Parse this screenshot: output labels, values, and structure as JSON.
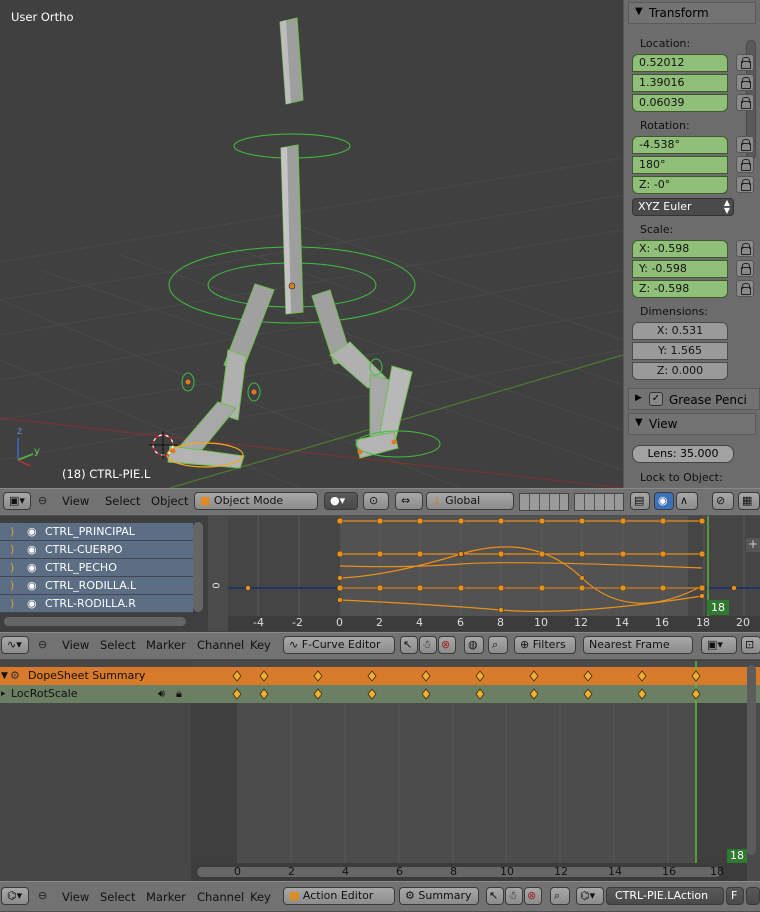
{
  "viewport": {
    "view_name": "User Ortho",
    "object_label": "(18) CTRL-PIE.L",
    "axis_z": "z",
    "axis_y": "y"
  },
  "properties": {
    "transform_title": "Transform",
    "location_label": "Location:",
    "location": [
      "0.52012",
      "1.39016",
      "0.06039"
    ],
    "rotation_label": "Rotation:",
    "rotation": [
      "-4.538°",
      "180°",
      "Z: -0°"
    ],
    "rotation_mode": "XYZ Euler",
    "scale_label": "Scale:",
    "scale": [
      "X: -0.598",
      "Y: -0.598",
      "Z: -0.598"
    ],
    "dimensions_label": "Dimensions:",
    "dimensions": [
      "X: 0.531",
      "Y: 1.565",
      "Z: 0.000"
    ],
    "grease_pencil_label": "Grease Penci",
    "view_title": "View",
    "lens": "Lens: 35.000",
    "lock_to_object": "Lock to Object:"
  },
  "view3d_header": {
    "menus": [
      "View",
      "Select",
      "Object"
    ],
    "mode": "Object Mode",
    "orientation": "Global"
  },
  "graph_editor": {
    "channels": [
      "CTRL_PRINCIPAL",
      "CTRL-CUERPO",
      "CTRL_PECHO",
      "CTRL_RODILLA.L",
      "CTRL-RODILLA.R"
    ],
    "ruler": [
      "-4",
      "-2",
      "0",
      "2",
      "4",
      "6",
      "8",
      "10",
      "12",
      "14",
      "16",
      "18",
      "20"
    ],
    "current_frame": "18",
    "y_zero": "0"
  },
  "graph_header": {
    "menus": [
      "View",
      "Select",
      "Marker",
      "Channel",
      "Key"
    ],
    "editor_type": "F-Curve Editor",
    "filters": "Filters",
    "snap": "Nearest Frame"
  },
  "dopesheet": {
    "summary": "DopeSheet Summary",
    "action_channel": "LocRotScale",
    "ruler": [
      "0",
      "2",
      "4",
      "6",
      "8",
      "10",
      "12",
      "14",
      "16",
      "18"
    ],
    "current_frame": "18"
  },
  "dopesheet_header": {
    "menus": [
      "View",
      "Select",
      "Marker",
      "Channel",
      "Key"
    ],
    "mode": "Action Editor",
    "summary_button": "Summary",
    "action_name": "CTRL-PIE.LAction",
    "fake_user": "F"
  },
  "colors": {
    "viewport_bg": "#404040",
    "panel_bg": "#6c6c6c",
    "field_green": "#8fbf78",
    "keyframe_orange": "#f5a623",
    "summary_orange": "#d77a2a",
    "channel_blue": "#5b6e84"
  }
}
